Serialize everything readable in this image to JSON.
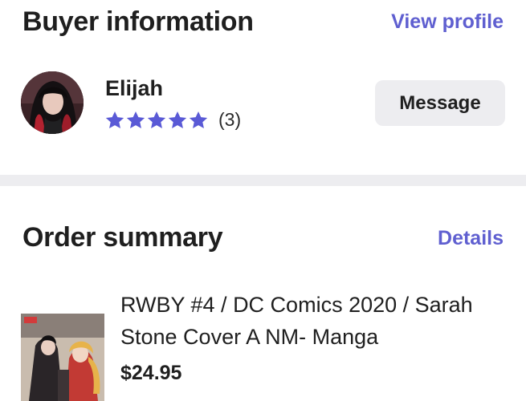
{
  "buyer": {
    "section_title": "Buyer information",
    "view_profile_label": "View profile",
    "name": "Elijah",
    "rating": 5,
    "rating_count": "(3)",
    "message_label": "Message"
  },
  "order": {
    "section_title": "Order summary",
    "details_label": "Details",
    "item": {
      "title": "RWBY #4 / DC Comics 2020 / Sarah Stone Cover A NM- Manga",
      "price": "$24.95"
    }
  },
  "colors": {
    "accent": "#5f5fd0",
    "star": "#5a5ad6",
    "button_bg": "#ededf0",
    "divider": "#ededf0",
    "text": "#1f1f1f"
  },
  "icons": {
    "star": "star-icon"
  }
}
